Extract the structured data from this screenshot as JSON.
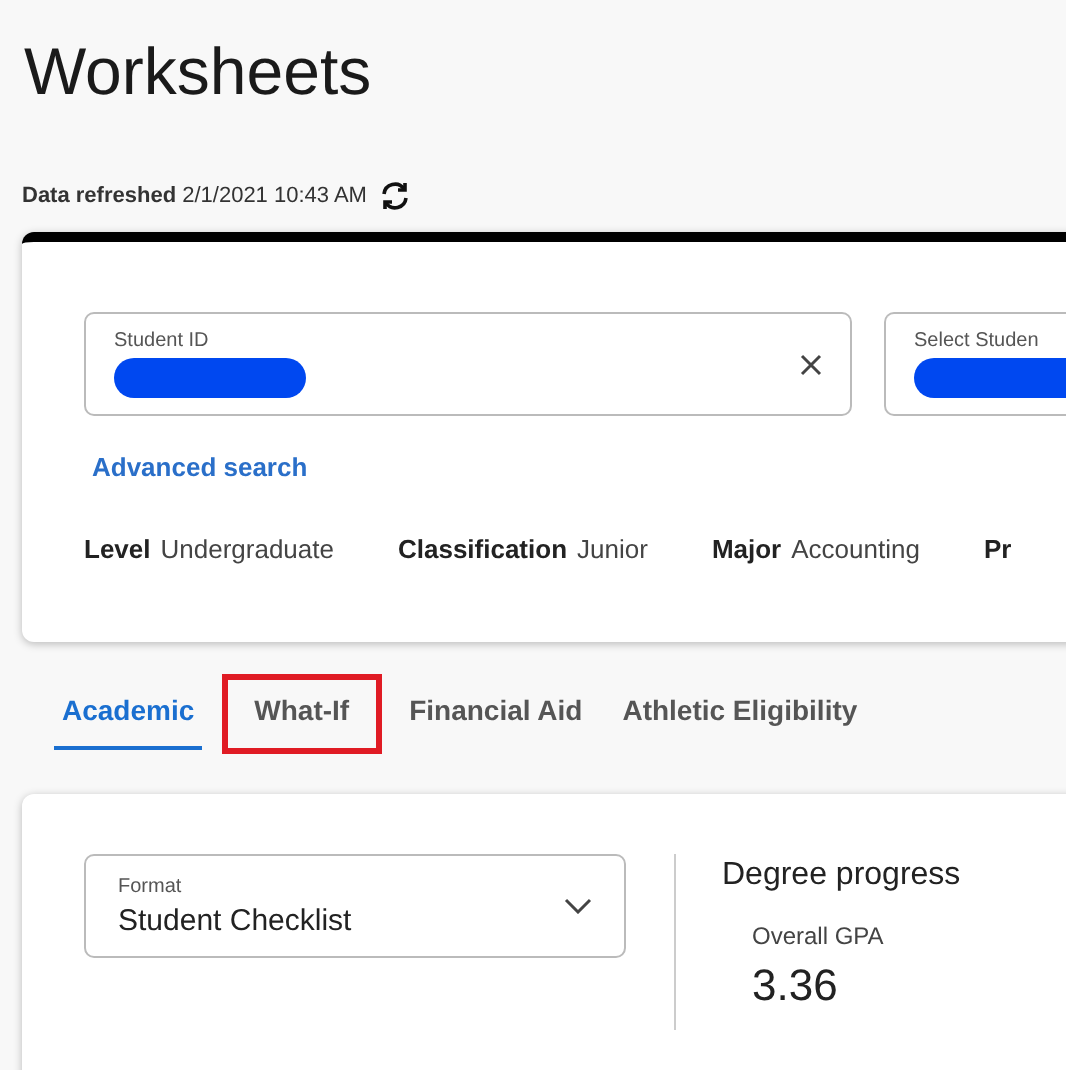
{
  "title": "Worksheets",
  "refresh": {
    "label": "Data refreshed",
    "value": "2/1/2021 10:43 AM"
  },
  "student_card": {
    "fields": [
      {
        "label": "Student ID",
        "redacted": true,
        "clearable": true
      },
      {
        "label": "Select Studen",
        "redacted": true,
        "clearable": false
      }
    ],
    "advanced_search": "Advanced search",
    "info": [
      {
        "label": "Level",
        "value": "Undergraduate"
      },
      {
        "label": "Classification",
        "value": "Junior"
      },
      {
        "label": "Major",
        "value": "Accounting"
      },
      {
        "label": "Pr"
      }
    ]
  },
  "tabs": [
    {
      "label": "Academic",
      "selected": true,
      "highlighted": false
    },
    {
      "label": "What-If",
      "selected": false,
      "highlighted": true
    },
    {
      "label": "Financial Aid",
      "selected": false,
      "highlighted": false
    },
    {
      "label": "Athletic Eligibility",
      "selected": false,
      "highlighted": false
    }
  ],
  "worksheet": {
    "format": {
      "label": "Format",
      "value": "Student Checklist"
    },
    "progress": {
      "title": "Degree progress",
      "gpa_label": "Overall GPA",
      "gpa": "3.36"
    }
  }
}
